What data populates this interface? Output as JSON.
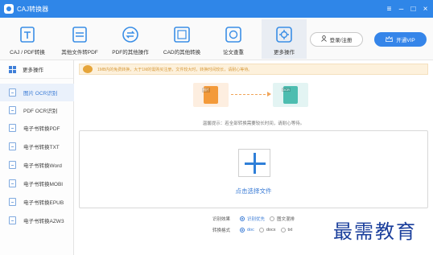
{
  "app": {
    "title": "CAJ转换器"
  },
  "window_controls": [
    "≡",
    "–",
    "□",
    "×"
  ],
  "toolbar": {
    "tools": [
      {
        "label": "CAJ / PDF转换",
        "icon": "caj-convert-icon",
        "color": "#3a8ee6"
      },
      {
        "label": "其他文件转PDF",
        "icon": "file-to-pdf-icon",
        "color": "#3a8ee6"
      },
      {
        "label": "PDF的其他操作",
        "icon": "pdf-ops-icon",
        "color": "#3a8ee6"
      },
      {
        "label": "CAD的其他转换",
        "icon": "cad-convert-icon",
        "color": "#3a8ee6"
      },
      {
        "label": "论文查重",
        "icon": "paper-check-icon",
        "color": "#3a8ee6"
      },
      {
        "label": "更多操作",
        "icon": "more-ops-icon",
        "color": "#3a8ee6"
      }
    ],
    "active_tool": "更多操作",
    "login_label": "登录/注册",
    "vip_label": "开通VIP"
  },
  "sidebar": {
    "header": "更多操作",
    "items": [
      {
        "label": "图片 OCR识别"
      },
      {
        "label": "PDF OCR识别"
      },
      {
        "label": "电子书转换PDF"
      },
      {
        "label": "电子书转换TXT"
      },
      {
        "label": "电子书转换Word"
      },
      {
        "label": "电子书转换MOBI"
      },
      {
        "label": "电子书转换EPUB"
      },
      {
        "label": "电子书转换AZW3"
      }
    ],
    "active_item": "图片 OCR识别"
  },
  "notice": {
    "text": "1MB内的免费转换，大于1M的需购买注册，文件较大时，转换时间较长，请耐心等待。"
  },
  "conversion": {
    "from_tag": "图片",
    "to_tag": "OCR"
  },
  "tip": "温馨提示：若全部转换需要较长时间，请耐心等待。",
  "dropzone": {
    "label": "点击选择文件"
  },
  "options": {
    "recognize": {
      "label": "识别效果",
      "choices": [
        "识别优先",
        "图文混排"
      ],
      "selected": "识别优先"
    },
    "format": {
      "label": "转换格式",
      "choices": [
        "doc",
        "docx",
        "txt"
      ],
      "selected": "doc"
    }
  },
  "watermark": "最需教育",
  "colors": {
    "accent": "#2f86e8",
    "notice_bg": "#fdf1dc",
    "orange": "#f39a3a",
    "teal": "#4dbdb0"
  }
}
